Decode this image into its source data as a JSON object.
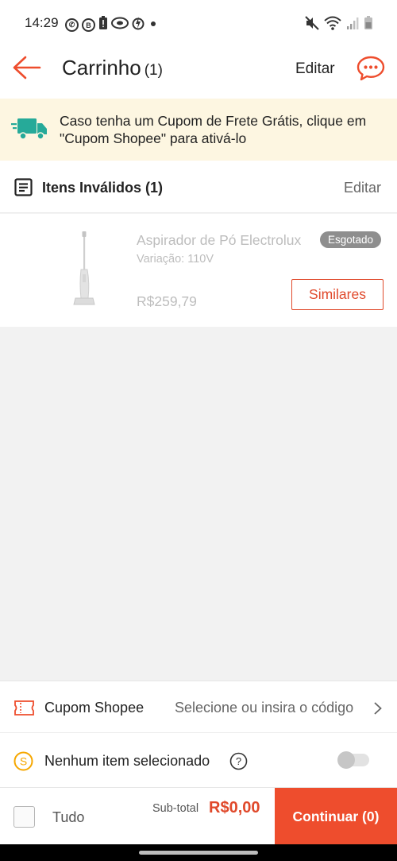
{
  "status_bar": {
    "time": "14:29",
    "left_icons": [
      "whatsapp-icon",
      "b-icon",
      "battery-alert-icon",
      "disc-icon",
      "lightning-icon",
      "dot-icon"
    ],
    "right_icons": [
      "mute-icon",
      "wifi-icon",
      "signal-icon",
      "battery-icon"
    ]
  },
  "header": {
    "title": "Carrinho",
    "count": "(1)",
    "edit_label": "Editar"
  },
  "banner": {
    "text": "Caso tenha um Cupom de Frete Grátis, clique em \"Cupom Shopee\" para ativá-lo"
  },
  "invalid_section": {
    "title": "Itens Inválidos (1)",
    "edit_label": "Editar"
  },
  "item": {
    "name": "Aspirador de Pó Electrolux",
    "badge": "Esgotado",
    "variation": "Variação: 110V",
    "price": "R$259,79",
    "similar_label": "Similares"
  },
  "coupon": {
    "label": "Cupom Shopee",
    "hint": "Selecione ou insira o código"
  },
  "coins": {
    "label": "Nenhum item selecionado",
    "toggle_on": false
  },
  "footer": {
    "select_all_label": "Tudo",
    "subtotal_label": "Sub-total",
    "subtotal_value": "R$0,00",
    "checkout_label": "Continuar (0)"
  },
  "colors": {
    "accent": "#ee4d2d",
    "banner_bg": "#fdf6e1",
    "truck": "#26aa99"
  }
}
